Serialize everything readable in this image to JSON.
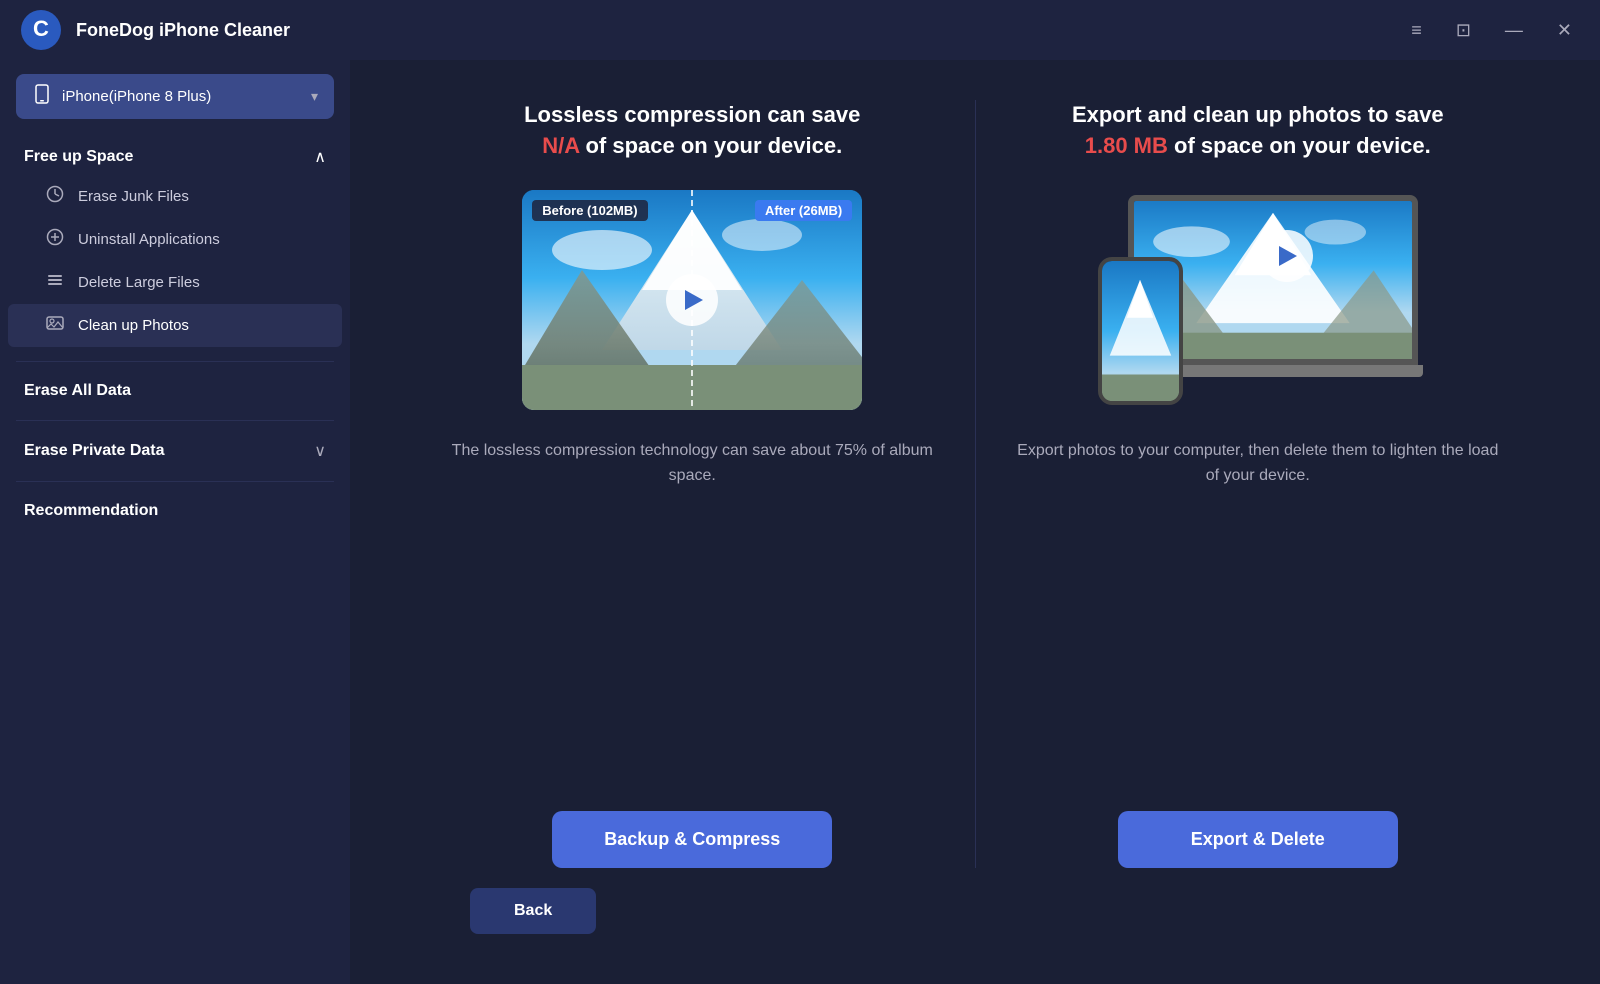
{
  "app": {
    "title": "FoneDog iPhone Cleaner",
    "logo_letter": "C"
  },
  "title_controls": {
    "menu_icon": "≡",
    "chat_icon": "⊡",
    "minimize_icon": "—",
    "close_icon": "✕"
  },
  "device_selector": {
    "label": "iPhone(iPhone 8 Plus)",
    "icon": "📱"
  },
  "sidebar": {
    "free_up_space": {
      "title": "Free up Space",
      "items": [
        {
          "id": "erase-junk",
          "label": "Erase Junk Files",
          "icon": "🕐"
        },
        {
          "id": "uninstall-apps",
          "label": "Uninstall Applications",
          "icon": "⊗"
        },
        {
          "id": "delete-large",
          "label": "Delete Large Files",
          "icon": "☰"
        },
        {
          "id": "clean-photos",
          "label": "Clean up Photos",
          "icon": "🖼"
        }
      ]
    },
    "erase_all": {
      "title": "Erase All Data"
    },
    "erase_private": {
      "title": "Erase Private Data"
    },
    "recommendation": {
      "title": "Recommendation"
    }
  },
  "panels": {
    "left": {
      "heading_part1": "Lossless compression can save",
      "heading_highlight": "N/A",
      "heading_part2": "of space on your device.",
      "highlight_color": "red",
      "before_label": "Before (102MB)",
      "after_label": "After (26MB)",
      "description": "The lossless compression technology can save about 75% of album space.",
      "button_label": "Backup & Compress"
    },
    "right": {
      "heading_part1": "Export and clean up photos to save",
      "heading_highlight": "1.80 MB",
      "heading_part2": "of space on your device.",
      "highlight_color": "red",
      "description": "Export photos to your computer, then delete them to lighten the load of your device.",
      "button_label": "Export & Delete"
    }
  },
  "back_button": {
    "label": "Back"
  }
}
